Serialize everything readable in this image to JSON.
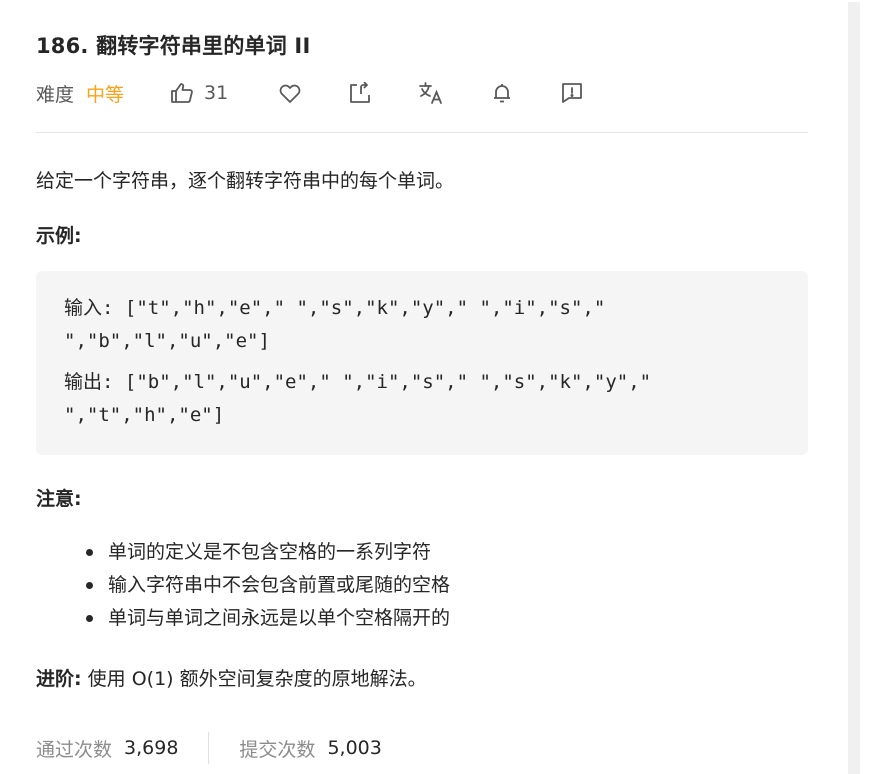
{
  "problem": {
    "title": "186. 翻转字符串里的单词 II",
    "difficulty_label": "难度",
    "difficulty_value": "中等",
    "likes": "31"
  },
  "toolbar_icons": [
    "thumbs-up-icon",
    "heart-icon",
    "share-icon",
    "translate-icon",
    "bell-icon",
    "feedback-icon"
  ],
  "colors": {
    "difficulty_medium": "#ffa116",
    "text": "#262626",
    "muted": "#8c8c8c",
    "code_bg": "#f5f5f5"
  },
  "description": "给定一个字符串，逐个翻转字符串中的每个单词。",
  "example": {
    "heading": "示例:",
    "lines": [
      "输入: [\"t\",\"h\",\"e\",\" \",\"s\",\"k\",\"y\",\" \",\"i\",\"s\",\"",
      "\",\"b\",\"l\",\"u\",\"e\"]",
      "输出: [\"b\",\"l\",\"u\",\"e\",\" \",\"i\",\"s\",\" \",\"s\",\"k\",\"y\",\"",
      "\",\"t\",\"h\",\"e\"]"
    ]
  },
  "notes": {
    "heading": "注意:",
    "items": [
      "单词的定义是不包含空格的一系列字符",
      "输入字符串中不会包含前置或尾随的空格",
      "单词与单词之间永远是以单个空格隔开的"
    ]
  },
  "advanced": {
    "label": "进阶:",
    "text": "使用 O(1) 额外空间复杂度的原地解法。"
  },
  "stats": {
    "accepted_label": "通过次数",
    "accepted_value": "3,698",
    "submissions_label": "提交次数",
    "submissions_value": "5,003"
  }
}
